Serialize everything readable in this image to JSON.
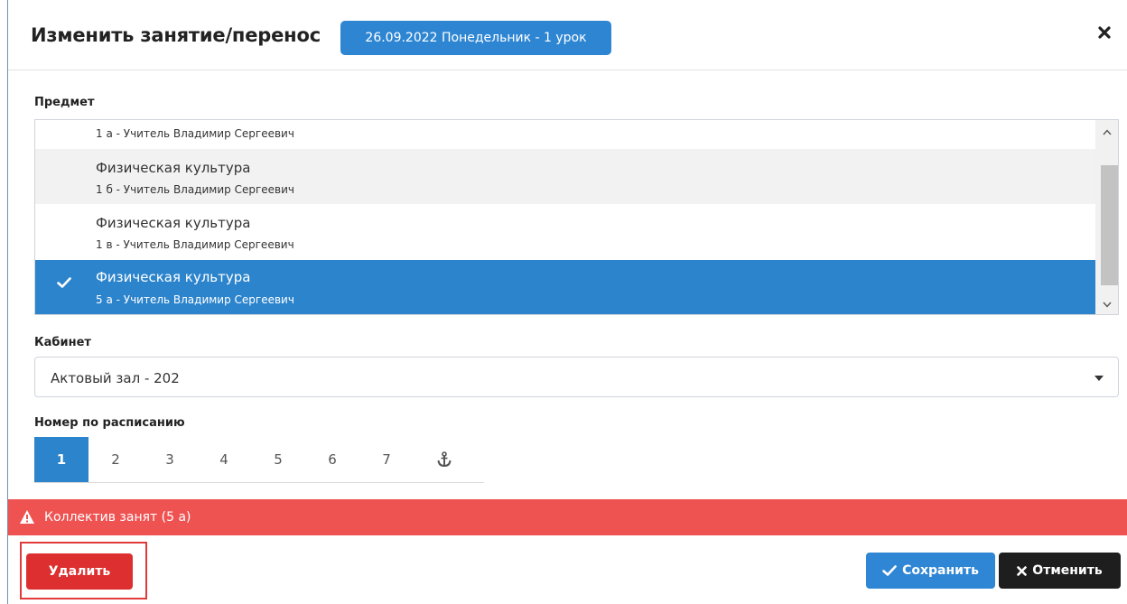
{
  "header": {
    "title": "Изменить занятие/перенос",
    "date_badge": "26.09.2022 Понедельник - 1 урок"
  },
  "subject": {
    "label": "Предмет",
    "items": [
      {
        "subject": "",
        "detail": "1 а - Учитель Владимир Сергеевич",
        "selected": false
      },
      {
        "subject": "Физическая культура",
        "detail": "1 б - Учитель Владимир Сергеевич",
        "selected": false
      },
      {
        "subject": "Физическая культура",
        "detail": "1 в - Учитель Владимир Сергеевич",
        "selected": false
      },
      {
        "subject": "Физическая культура",
        "detail": "5 а - Учитель Владимир Сергеевич",
        "selected": true
      }
    ]
  },
  "cabinet": {
    "label": "Кабинет",
    "value": "Актовый зал - 202"
  },
  "schedule": {
    "label": "Номер по расписанию",
    "numbers": [
      "1",
      "2",
      "3",
      "4",
      "5",
      "6",
      "7"
    ],
    "active": "1",
    "extra_icon": "anchor-icon"
  },
  "alert": {
    "text": "Коллектив занят (5 а)",
    "icon": "warning-icon"
  },
  "footer": {
    "delete_label": "Удалить",
    "save_label": "Сохранить",
    "cancel_label": "Отменить"
  },
  "colors": {
    "primary": "#2c84cc",
    "danger": "#ee5352",
    "delete": "#dd2f2f",
    "dark": "#1e1e1e"
  }
}
